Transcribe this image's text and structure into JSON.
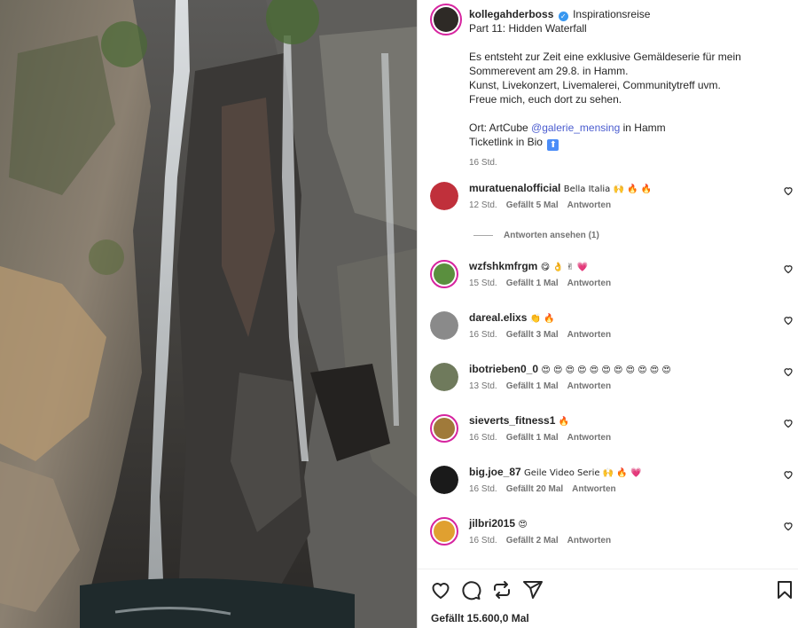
{
  "post": {
    "username": "kollegahderboss",
    "location": "Inspirationsreise",
    "caption_lines": [
      "Part 11: Hidden Waterfall",
      "Es entsteht zur Zeit eine exklusive Gemäldeserie für mein",
      "Sommerevent am 29.8. in Hamm.",
      "Kunst, Livekonzert, Livemalerei, Communitytreff uvm.",
      "Freue mich, euch dort zu sehen.",
      "Ort: ArtCube ",
      "@galerie_mensing",
      " in Hamm",
      "Ticketlink in Bio"
    ],
    "time": "16 Std.",
    "likes_text": "Gefällt 15.600,0 Mal"
  },
  "comments": [
    {
      "user": "muratuenalofficial",
      "text": "Bella Italia 🙌 🔥 🔥",
      "time": "12 Std.",
      "likes": "Gefällt 5 Mal",
      "reply": "Antworten",
      "avatar_color": "#c0303b"
    },
    {
      "user": "wzfshkmfrgm",
      "text": "😋 👌 ✌ 💗",
      "time": "15 Std.",
      "likes": "Gefällt 1 Mal",
      "reply": "Antworten",
      "avatar_color": "#5a8f3e"
    },
    {
      "user": "dareal.elixs",
      "text": "👏 🔥",
      "time": "16 Std.",
      "likes": "Gefällt 3 Mal",
      "reply": "Antworten",
      "avatar_color": "#8a8a8a"
    },
    {
      "user": "ibotrieben0_0",
      "text": "😍 😍 😍 😍 😍 😍 😍 😍 😍 😍 😍",
      "time": "13 Std.",
      "likes": "Gefällt 1 Mal",
      "reply": "Antworten",
      "avatar_color": "#6f7a5c"
    },
    {
      "user": "sieverts_fitness1",
      "text": "🔥",
      "time": "16 Std.",
      "likes": "Gefällt 1 Mal",
      "reply": "Antworten",
      "avatar_color": "#a07a3a"
    },
    {
      "user": "big.joe_87",
      "text": "Geile Video Serie 🙌 🔥 💗",
      "time": "16 Std.",
      "likes": "Gefällt 20 Mal",
      "reply": "Antworten",
      "avatar_color": "#1a1a1a"
    },
    {
      "user": "jilbri2015",
      "text": "😍",
      "time": "16 Std.",
      "likes": "Gefällt 2 Mal",
      "reply": "Antworten",
      "avatar_color": "#e0a030"
    }
  ],
  "view_replies": "Antworten ansehen (1)",
  "icons": {
    "like": "heart-icon",
    "comment": "comment-icon",
    "share": "repost-icon",
    "send": "send-icon",
    "save": "bookmark-icon"
  }
}
